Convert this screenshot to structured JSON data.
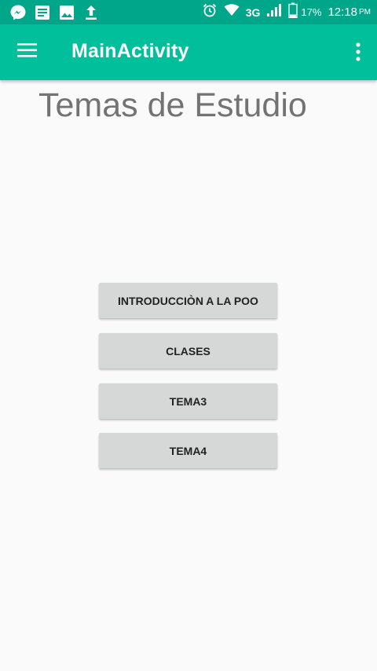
{
  "status_bar": {
    "network": "3G",
    "battery": "17%",
    "time": "12:18",
    "ampm": "PM"
  },
  "app_bar": {
    "title": "MainActivity",
    "background": "#00bf9a"
  },
  "page": {
    "heading": "Temas de Estudio"
  },
  "buttons": [
    {
      "label": "INTRODUCCIÒN A LA POO"
    },
    {
      "label": "CLASES"
    },
    {
      "label": "TEMA3"
    },
    {
      "label": "TEMA4"
    }
  ],
  "icons": [
    "messenger-icon",
    "notes-icon",
    "image-icon",
    "upload-icon",
    "alarm-icon",
    "wifi-icon",
    "signal-icon",
    "battery-icon",
    "hamburger-icon",
    "overflow-icon"
  ]
}
